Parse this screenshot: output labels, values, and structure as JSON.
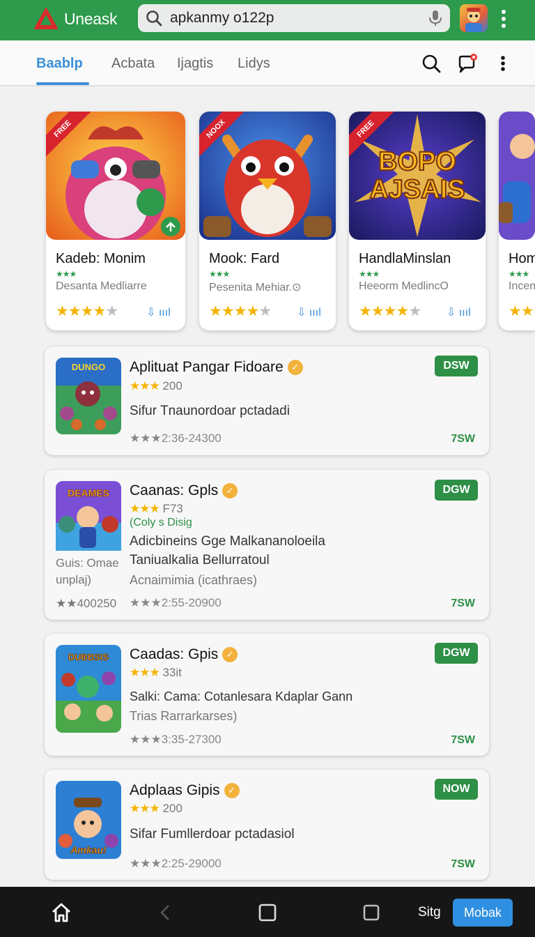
{
  "header": {
    "app_name": "Uneask",
    "search_value": "apkanmy o122p",
    "icons": [
      "warning-triangle-icon",
      "search-icon",
      "mic-icon",
      "avatar",
      "more-vert-icon"
    ],
    "colors": {
      "brand_green": "#2e9a4c",
      "accent_blue": "#3b8fd9"
    }
  },
  "tabs": {
    "items": [
      {
        "label": "Baablp",
        "active": true
      },
      {
        "label": "Acbata",
        "active": false
      },
      {
        "label": "Ijagtis",
        "active": false
      },
      {
        "label": "Lidys",
        "active": false
      }
    ],
    "icons": [
      "search-icon",
      "chat-alert-icon",
      "more-vert-icon"
    ]
  },
  "featured": [
    {
      "badge": "FREE",
      "name": "Kadeb: Monim",
      "minis": "★★★",
      "developer": "Desanta Medliarre",
      "rating": 4,
      "download_label": "⇩ ıııl",
      "art_title": ""
    },
    {
      "badge": "NOOX",
      "name": "Mook: Fard",
      "minis": "★★★",
      "developer": "Pesenita Mehiar.⊙",
      "rating": 4,
      "download_label": "⇩ ıııl",
      "art_title": ""
    },
    {
      "badge": "FREE",
      "name": "HandlaMinslan",
      "minis": "★★★",
      "developer": "Heeorm MedlincO",
      "rating": 4,
      "download_label": "⇩ ıııl",
      "art_title": "BOPO AJSAIS"
    },
    {
      "badge": "",
      "name": "Hom",
      "minis": "★★★",
      "developer": "Incen",
      "rating": 1,
      "download_label": "",
      "art_title": ""
    }
  ],
  "list": [
    {
      "title": "Aplituat Pangar Fidoare",
      "rating_stars": "★★★",
      "rating_count": "200",
      "line1": "Sifur Tnaunordoar pctadadi",
      "meta": "★★★2:36-24300",
      "button": "DSW",
      "size": "7SW",
      "thumb_title": "DUNGO"
    },
    {
      "title": "Caanas: Gpls",
      "rating_stars": "★★★",
      "rating_count": "F73",
      "green_text": "(Coly s Disig",
      "line1": "Adicbineins Gge Malkananoloeila",
      "line2": "Taniualkalia Bellurratoul",
      "sub": "Acnaimimia (icathraes)",
      "left_note_1": "Guis: Omae",
      "left_note_2": "unplaj)",
      "left_meta": "★★400250",
      "meta": "★★★2:55-20900",
      "button": "DGW",
      "size": "7SW",
      "thumb_title": "DEAMES"
    },
    {
      "title": "Caadas: Gpis",
      "rating_stars": "★★★",
      "rating_count": "33it",
      "line1": "Salki: Cama: Cotanlesara Kdaplar Gann",
      "sub": "Trias Rarrarkarses)",
      "meta": "★★★3:35-27300",
      "button": "DGW",
      "size": "7SW",
      "thumb_title": "DUBBSIS"
    },
    {
      "title": "Adplaas Gipis",
      "rating_stars": "★★★",
      "rating_count": "200",
      "line1": "Sifar Fumllerdoar pctadasiol",
      "meta": "★★★2:25-29000",
      "button": "NOW",
      "size": "7SW",
      "thumb_title": "Amkau!"
    }
  ],
  "bottom_nav": {
    "icons": [
      "home-icon",
      "back-icon",
      "recents-icon",
      "square-icon"
    ],
    "text": "Sitg",
    "button": "Mobak"
  }
}
